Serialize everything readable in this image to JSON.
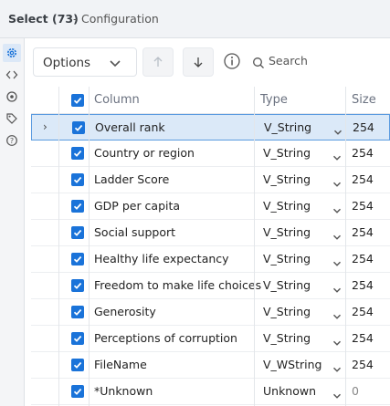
{
  "title": {
    "main": "Select (73)",
    "sep": "-",
    "sub": "Configuration"
  },
  "side_icons": [
    "gear-icon",
    "code-icon",
    "target-icon",
    "tag-icon",
    "help-icon"
  ],
  "toolbar": {
    "options_label": "Options",
    "search_placeholder": "Search"
  },
  "columns": {
    "column": "Column",
    "type": "Type",
    "size": "Size"
  },
  "rows": [
    {
      "name": "Overall rank",
      "type": "V_String",
      "size": "254",
      "checked": true
    },
    {
      "name": "Country or region",
      "type": "V_String",
      "size": "254",
      "checked": true
    },
    {
      "name": "Ladder Score",
      "type": "V_String",
      "size": "254",
      "checked": true
    },
    {
      "name": "GDP per capita",
      "type": "V_String",
      "size": "254",
      "checked": true
    },
    {
      "name": "Social support",
      "type": "V_String",
      "size": "254",
      "checked": true
    },
    {
      "name": "Healthy life expectancy",
      "type": "V_String",
      "size": "254",
      "checked": true
    },
    {
      "name": "Freedom to make life choices",
      "type": "V_String",
      "size": "254",
      "checked": true
    },
    {
      "name": "Generosity",
      "type": "V_String",
      "size": "254",
      "checked": true
    },
    {
      "name": "Perceptions of corruption",
      "type": "V_String",
      "size": "254",
      "checked": true
    },
    {
      "name": "FileName",
      "type": "V_WString",
      "size": "254",
      "checked": true
    },
    {
      "name": "*Unknown",
      "type": "Unknown",
      "size": "0",
      "checked": true
    }
  ],
  "colors": {
    "accent": "#1a73d9",
    "selected_row_bg": "#dbe9f8",
    "selected_row_border": "#5b9be0"
  }
}
